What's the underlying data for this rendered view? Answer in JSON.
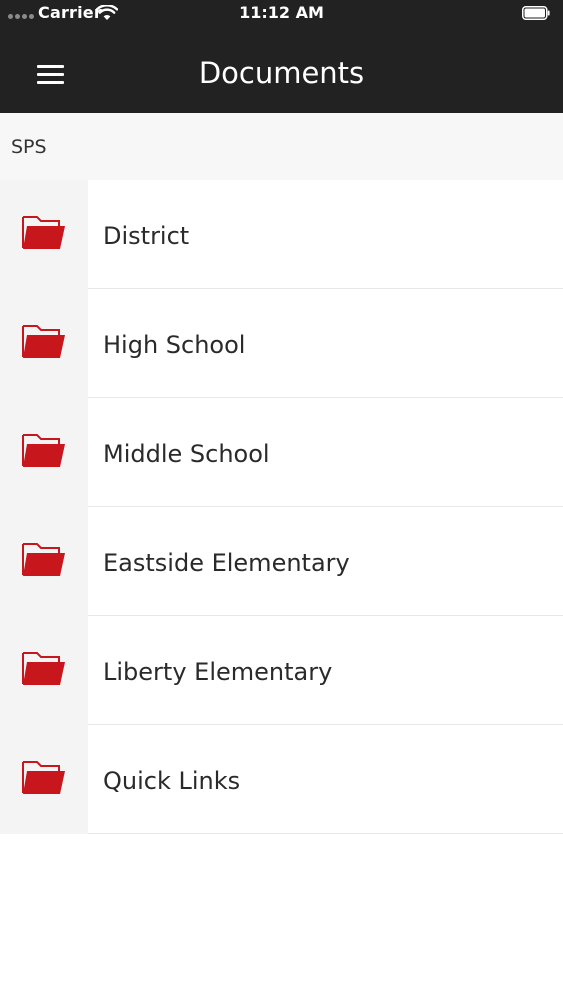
{
  "status_bar": {
    "carrier": "Carrier",
    "time": "11:12 AM"
  },
  "nav": {
    "title": "Documents",
    "menu_icon": "hamburger-menu-icon"
  },
  "breadcrumb": {
    "label": "SPS"
  },
  "folders": [
    {
      "label": "District",
      "icon": "folder-icon"
    },
    {
      "label": "High School",
      "icon": "folder-icon"
    },
    {
      "label": "Middle School",
      "icon": "folder-icon"
    },
    {
      "label": "Eastside Elementary",
      "icon": "folder-icon"
    },
    {
      "label": "Liberty Elementary",
      "icon": "folder-icon"
    },
    {
      "label": "Quick Links",
      "icon": "folder-icon"
    }
  ],
  "colors": {
    "header_background": "#222222",
    "folder_red": "#c8161d",
    "header_text": "#ffffff"
  }
}
